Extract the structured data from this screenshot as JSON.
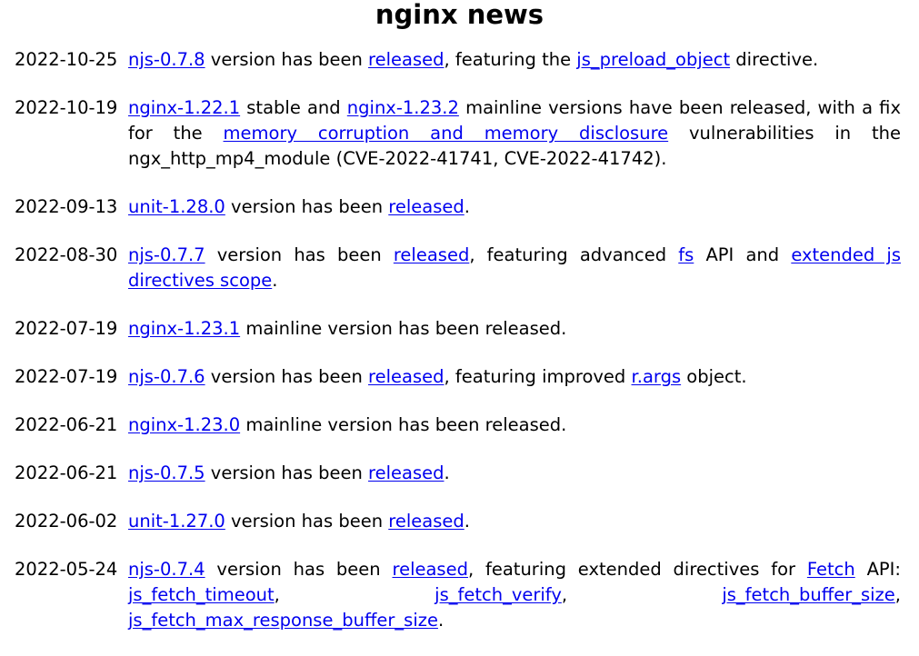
{
  "page": {
    "title": "nginx news"
  },
  "entries": [
    {
      "date": "2022-10-25",
      "parts": [
        {
          "type": "link",
          "text": "njs-0.7.8"
        },
        {
          "type": "text",
          "text": " version has been "
        },
        {
          "type": "link",
          "text": "released"
        },
        {
          "type": "text",
          "text": ", featuring the "
        },
        {
          "type": "link",
          "text": "js_preload_object"
        },
        {
          "type": "text",
          "text": " directive."
        }
      ]
    },
    {
      "date": "2022-10-19",
      "parts": [
        {
          "type": "link",
          "text": "nginx-1.22.1"
        },
        {
          "type": "text",
          "text": " stable and "
        },
        {
          "type": "link",
          "text": "nginx-1.23.2"
        },
        {
          "type": "text",
          "text": " mainline versions have been released, with a fix for the "
        },
        {
          "type": "link",
          "text": "memory corruption and memory disclosure"
        },
        {
          "type": "text",
          "text": " vulnerabilities in the ngx_http_mp4_module (CVE-2022-41741, CVE-2022-41742)."
        }
      ]
    },
    {
      "date": "2022-09-13",
      "parts": [
        {
          "type": "link",
          "text": "unit-1.28.0"
        },
        {
          "type": "text",
          "text": " version has been "
        },
        {
          "type": "link",
          "text": "released"
        },
        {
          "type": "text",
          "text": "."
        }
      ]
    },
    {
      "date": "2022-08-30",
      "parts": [
        {
          "type": "link",
          "text": "njs-0.7.7"
        },
        {
          "type": "text",
          "text": " version has been "
        },
        {
          "type": "link",
          "text": "released"
        },
        {
          "type": "text",
          "text": ", featuring advanced "
        },
        {
          "type": "link",
          "text": "fs"
        },
        {
          "type": "text",
          "text": " API and "
        },
        {
          "type": "link",
          "text": "extended js directives scope"
        },
        {
          "type": "text",
          "text": "."
        }
      ]
    },
    {
      "date": "2022-07-19",
      "parts": [
        {
          "type": "link",
          "text": "nginx-1.23.1"
        },
        {
          "type": "text",
          "text": " mainline version has been released."
        }
      ]
    },
    {
      "date": "2022-07-19",
      "parts": [
        {
          "type": "link",
          "text": "njs-0.7.6"
        },
        {
          "type": "text",
          "text": " version has been "
        },
        {
          "type": "link",
          "text": "released"
        },
        {
          "type": "text",
          "text": ", featuring improved "
        },
        {
          "type": "link",
          "text": "r.args"
        },
        {
          "type": "text",
          "text": " object."
        }
      ]
    },
    {
      "date": "2022-06-21",
      "parts": [
        {
          "type": "link",
          "text": "nginx-1.23.0"
        },
        {
          "type": "text",
          "text": " mainline version has been released."
        }
      ]
    },
    {
      "date": "2022-06-21",
      "parts": [
        {
          "type": "link",
          "text": "njs-0.7.5"
        },
        {
          "type": "text",
          "text": " version has been "
        },
        {
          "type": "link",
          "text": "released"
        },
        {
          "type": "text",
          "text": "."
        }
      ]
    },
    {
      "date": "2022-06-02",
      "parts": [
        {
          "type": "link",
          "text": "unit-1.27.0"
        },
        {
          "type": "text",
          "text": " version has been "
        },
        {
          "type": "link",
          "text": "released"
        },
        {
          "type": "text",
          "text": "."
        }
      ]
    },
    {
      "date": "2022-05-24",
      "parts": [
        {
          "type": "link",
          "text": "njs-0.7.4"
        },
        {
          "type": "text",
          "text": " version has been "
        },
        {
          "type": "link",
          "text": "released"
        },
        {
          "type": "text",
          "text": ", featuring extended directives for "
        },
        {
          "type": "link",
          "text": "Fetch"
        },
        {
          "type": "text",
          "text": " API: "
        },
        {
          "type": "link",
          "text": "js_fetch_timeout"
        },
        {
          "type": "text",
          "text": ", "
        },
        {
          "type": "link",
          "text": "js_fetch_verify"
        },
        {
          "type": "text",
          "text": ", "
        },
        {
          "type": "link",
          "text": "js_fetch_buffer_size"
        },
        {
          "type": "text",
          "text": ", "
        },
        {
          "type": "link",
          "text": "js_fetch_max_response_buffer_size"
        },
        {
          "type": "text",
          "text": "."
        }
      ]
    }
  ],
  "colors": {
    "link": "#0000ee",
    "text": "#000000",
    "background": "#ffffff"
  }
}
